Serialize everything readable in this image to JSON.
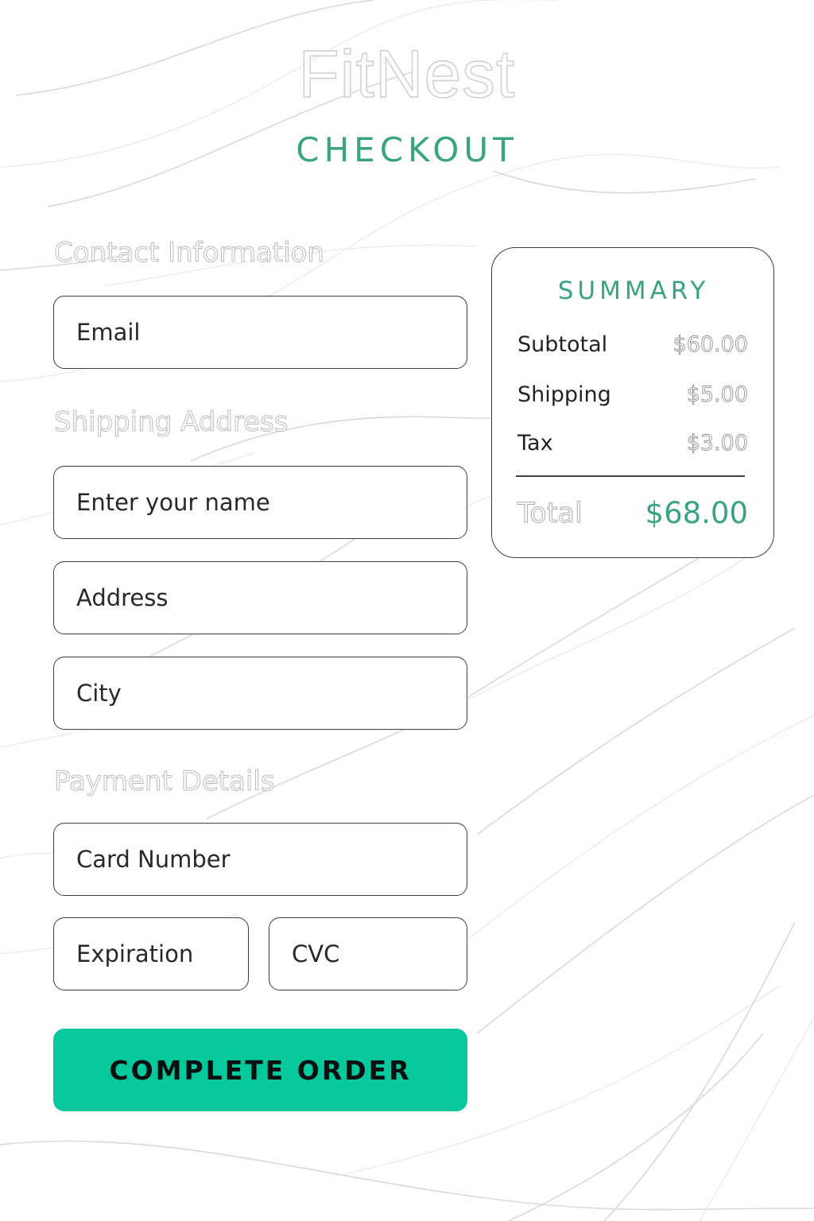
{
  "brand": {
    "logo_text": "FitNest",
    "accent_color": "#3aa382",
    "button_color": "#05c99c"
  },
  "page": {
    "title": "CHECKOUT"
  },
  "sections": {
    "contact": {
      "heading": "Contact Information",
      "email_placeholder": "Email"
    },
    "shipping": {
      "heading": "Shipping Address",
      "name_placeholder": "Enter your name",
      "address_placeholder": "Address",
      "city_placeholder": "City"
    },
    "payment": {
      "heading": "Payment Details",
      "card_number_placeholder": "Card Number",
      "expiration_placeholder": "Expiration",
      "cvc_placeholder": "CVC"
    }
  },
  "actions": {
    "submit_label": "COMPLETE ORDER"
  },
  "summary": {
    "title": "SUMMARY",
    "rows": [
      {
        "label": "Subtotal",
        "value": "$60.00"
      },
      {
        "label": "Shipping",
        "value": "$5.00"
      },
      {
        "label": "Tax",
        "value": "$3.00"
      }
    ],
    "total_label": "Total",
    "total_value": "$68.00"
  }
}
